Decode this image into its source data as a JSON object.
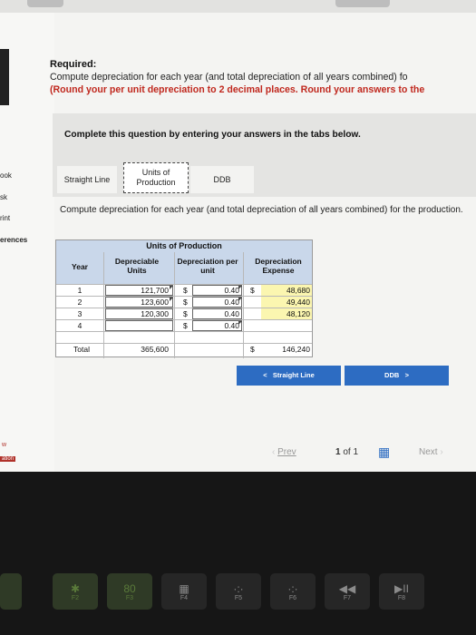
{
  "required": {
    "heading": "Required:",
    "line1": "Compute depreciation for each year (and total depreciation of all years combined) fo",
    "line2": "(Round your per unit depreciation to 2 decimal places. Round your answers to the"
  },
  "sidebar": [
    "ook",
    "sk",
    "rint",
    "erences"
  ],
  "sidebar_bottom": [
    "w",
    "ation"
  ],
  "instruction": "Complete this question by entering your answers in the tabs below.",
  "tabs": [
    {
      "label": "Straight Line"
    },
    {
      "label": "Units of Production"
    },
    {
      "label": "DDB"
    }
  ],
  "compute_text": "Compute depreciation for each year (and total depreciation of all years combined) for the production.",
  "table": {
    "title": "Units of Production",
    "headers": [
      "Year",
      "Depreciable Units",
      "Depreciation per unit",
      "Depreciation Expense"
    ],
    "rows": [
      {
        "year": "1",
        "units": "121,700",
        "cur": "$",
        "rate": "0.40",
        "cur2": "$",
        "expense": "48,680"
      },
      {
        "year": "2",
        "units": "123,600",
        "cur": "$",
        "rate": "0.40",
        "cur2": "",
        "expense": "49,440"
      },
      {
        "year": "3",
        "units": "120,300",
        "cur": "$",
        "rate": "0.40",
        "cur2": "",
        "expense": "48,120"
      },
      {
        "year": "4",
        "units": "",
        "cur": "$",
        "rate": "0.40",
        "cur2": "",
        "expense": ""
      }
    ],
    "total": {
      "label": "Total",
      "units": "365,600",
      "cur": "$",
      "expense": "146,240"
    }
  },
  "nav": {
    "prev_tab": "Straight Line",
    "next_tab": "DDB",
    "prev_arrow": "<",
    "next_arrow": ">"
  },
  "pager": {
    "prev": "Prev",
    "page": "1",
    "of": "of 1",
    "next": "Next"
  },
  "keys": [
    {
      "glyph": "✱",
      "fn": "F2",
      "green": true
    },
    {
      "glyph": "80",
      "fn": "F3",
      "green": true
    },
    {
      "glyph": "▦",
      "fn": "F4",
      "green": false
    },
    {
      "glyph": "·:·",
      "fn": "F5",
      "green": false
    },
    {
      "glyph": "·:·",
      "fn": "F6",
      "green": false
    },
    {
      "glyph": "◀◀",
      "fn": "F7",
      "green": false
    },
    {
      "glyph": "▶II",
      "fn": "F8",
      "green": false
    }
  ]
}
